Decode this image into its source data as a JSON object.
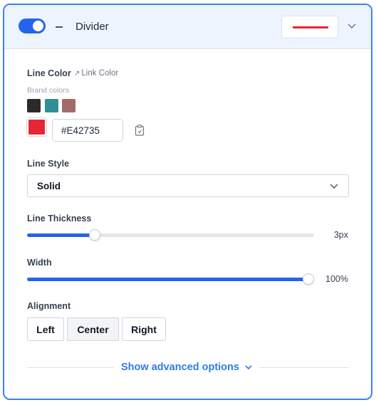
{
  "header": {
    "toggle_on": true,
    "title": "Divider",
    "preview_line_color": "#E42735"
  },
  "line_color": {
    "label": "Line Color",
    "link_label": "Link Color",
    "brand_label": "Brand colors",
    "brand_swatches": [
      "#2b2b2b",
      "#2f8f95",
      "#a26b6b"
    ],
    "current_hex": "#E42735"
  },
  "line_style": {
    "label": "Line Style",
    "selected": "Solid"
  },
  "line_thickness": {
    "label": "Line Thickness",
    "value_text": "3px",
    "fraction": 0.235
  },
  "width": {
    "label": "Width",
    "value_text": "100%",
    "fraction": 1.0
  },
  "alignment": {
    "label": "Alignment",
    "options": [
      "Left",
      "Center",
      "Right"
    ],
    "selected": "Center"
  },
  "advanced": {
    "label": "Show advanced options"
  },
  "colors": {
    "accent": "#2563eb",
    "panel_border": "#3b82f6",
    "link_blue": "#2b7ee6"
  }
}
